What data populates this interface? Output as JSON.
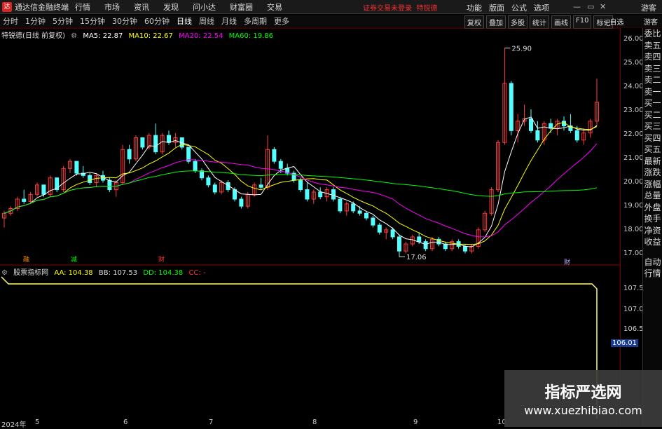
{
  "titlebar": {
    "app_title": "通达信金融终端",
    "menu": [
      "行情",
      "市场",
      "资讯",
      "发现",
      "问小达",
      "财富圈",
      "交易"
    ],
    "notice": "证券交易未登录",
    "notice2": "特锐德",
    "right_menu": [
      "功能",
      "版面",
      "公式",
      "选项"
    ],
    "guest": "游客"
  },
  "tabbar": {
    "tabs": [
      "分时",
      "1分钟",
      "5分钟",
      "15分钟",
      "30分钟",
      "60分钟",
      "日线",
      "周线",
      "月线",
      "多周期",
      "更多"
    ],
    "active": "日线",
    "tool_buttons": [
      "复权",
      "叠加",
      "多股",
      "统计",
      "画线",
      "F10",
      "标记"
    ],
    "auto_select": "+自选",
    "guest_btn": "游客"
  },
  "main_legend": {
    "name": "特锐德(日线 前复权)",
    "ma5": "MA5: 22.87",
    "ma10": "MA10: 22.67",
    "ma20": "MA20: 22.54",
    "ma60": "MA60: 19.86"
  },
  "sub_legend": {
    "name": "股票指标网",
    "aa": "AA: 104.38",
    "bb": "BB: 107.53",
    "dd": "DD: 104.38",
    "cc": "CC: -"
  },
  "price_axis": [
    "26.00",
    "25.00",
    "24.00",
    "23.00",
    "22.00",
    "21.00",
    "20.00",
    "19.00",
    "18.00",
    "17.00"
  ],
  "sub_axis": [
    "107.5",
    "107.0",
    "106.5",
    "106.01"
  ],
  "annotations": {
    "high": "25.90",
    "low": "17.06"
  },
  "markers": [
    "融",
    "减",
    "财",
    "财"
  ],
  "date_axis": [
    "2024年",
    "5",
    "6",
    "7",
    "8",
    "9",
    "10"
  ],
  "side_panel": [
    "委比",
    "卖五",
    "卖四",
    "卖三",
    "卖二",
    "卖一",
    "买一",
    "买二",
    "买三",
    "买四",
    "买五",
    "最新",
    "涨跌",
    "涨幅",
    "总量",
    "外盘",
    "换手",
    "净资",
    "收益",
    "自动",
    "行情"
  ],
  "watermark": {
    "line1": "指标严选网",
    "line2": "www.xuezhibiao.com"
  },
  "colors": {
    "up": "#ff3b3b",
    "down": "#54ffff",
    "ma5": "#ffffff",
    "ma10": "#ffff00",
    "ma20": "#ff00ff",
    "ma60": "#00ff00",
    "indicator": "#ffff66"
  },
  "chart_data": {
    "type": "candlestick",
    "title": "特锐德(日线 前复权)",
    "ylim": [
      16.8,
      26.3
    ],
    "candles": [
      [
        18.7,
        19.0,
        18.3,
        18.9
      ],
      [
        18.9,
        19.2,
        18.8,
        19.1
      ],
      [
        19.1,
        19.6,
        19.0,
        19.5
      ],
      [
        19.5,
        19.9,
        19.3,
        19.4
      ],
      [
        19.4,
        19.8,
        19.3,
        19.7
      ],
      [
        19.7,
        20.2,
        19.6,
        20.1
      ],
      [
        20.1,
        20.0,
        19.6,
        19.7
      ],
      [
        19.7,
        20.5,
        19.6,
        20.4
      ],
      [
        20.4,
        20.3,
        19.8,
        19.9
      ],
      [
        19.9,
        20.9,
        19.8,
        20.8
      ],
      [
        20.8,
        21.2,
        20.6,
        21.1
      ],
      [
        21.1,
        21.0,
        20.5,
        20.6
      ],
      [
        20.6,
        20.9,
        20.4,
        20.5
      ],
      [
        20.5,
        20.6,
        20.1,
        20.2
      ],
      [
        20.2,
        20.6,
        20.0,
        20.5
      ],
      [
        20.5,
        20.7,
        20.2,
        20.3
      ],
      [
        20.3,
        20.4,
        19.8,
        19.9
      ],
      [
        19.9,
        20.3,
        19.6,
        20.2
      ],
      [
        20.2,
        21.8,
        20.1,
        21.6
      ],
      [
        21.6,
        21.8,
        21.0,
        21.2
      ],
      [
        21.2,
        22.2,
        21.1,
        22.1
      ],
      [
        22.1,
        22.0,
        21.6,
        21.7
      ],
      [
        21.7,
        22.3,
        21.6,
        22.2
      ],
      [
        22.2,
        22.7,
        21.4,
        21.5
      ],
      [
        21.5,
        22.3,
        21.4,
        22.2
      ],
      [
        22.2,
        22.4,
        21.8,
        21.9
      ],
      [
        21.9,
        22.3,
        21.7,
        22.1
      ],
      [
        22.1,
        22.1,
        21.6,
        21.7
      ],
      [
        21.7,
        21.6,
        21.0,
        21.1
      ],
      [
        21.1,
        21.2,
        20.6,
        20.7
      ],
      [
        20.7,
        20.8,
        20.3,
        20.4
      ],
      [
        20.4,
        20.5,
        20.0,
        20.1
      ],
      [
        20.1,
        20.2,
        19.7,
        19.8
      ],
      [
        19.8,
        20.3,
        19.7,
        20.2
      ],
      [
        20.2,
        20.3,
        19.8,
        19.9
      ],
      [
        19.9,
        20.0,
        19.4,
        19.5
      ],
      [
        19.5,
        19.6,
        19.1,
        19.2
      ],
      [
        19.2,
        19.8,
        19.1,
        19.7
      ],
      [
        19.7,
        20.2,
        19.6,
        20.1
      ],
      [
        20.1,
        20.4,
        19.9,
        20.0
      ],
      [
        20.0,
        22.2,
        19.9,
        21.6
      ],
      [
        21.6,
        21.7,
        21.0,
        21.1
      ],
      [
        21.1,
        21.2,
        20.6,
        20.8
      ],
      [
        20.8,
        21.0,
        20.5,
        20.6
      ],
      [
        20.6,
        20.7,
        20.2,
        20.3
      ],
      [
        20.3,
        20.4,
        19.8,
        19.9
      ],
      [
        19.9,
        20.2,
        19.4,
        19.5
      ],
      [
        19.5,
        19.9,
        19.3,
        19.8
      ],
      [
        19.8,
        20.0,
        19.5,
        19.6
      ],
      [
        19.6,
        20.0,
        19.4,
        19.9
      ],
      [
        19.9,
        20.0,
        19.4,
        19.5
      ],
      [
        19.5,
        19.6,
        18.9,
        19.0
      ],
      [
        19.0,
        19.4,
        18.8,
        19.3
      ],
      [
        19.3,
        19.4,
        18.9,
        19.0
      ],
      [
        19.0,
        19.2,
        18.8,
        18.9
      ],
      [
        18.9,
        19.0,
        18.6,
        18.7
      ],
      [
        18.7,
        18.8,
        18.3,
        18.4
      ],
      [
        18.4,
        18.5,
        18.0,
        18.1
      ],
      [
        18.1,
        18.3,
        17.8,
        18.2
      ],
      [
        18.2,
        18.3,
        17.8,
        17.9
      ],
      [
        17.9,
        18.0,
        17.06,
        17.3
      ],
      [
        17.3,
        17.7,
        17.2,
        17.6
      ],
      [
        17.6,
        18.0,
        17.5,
        17.9
      ],
      [
        17.9,
        18.1,
        17.6,
        17.7
      ],
      [
        17.7,
        17.8,
        17.3,
        17.4
      ],
      [
        17.4,
        17.9,
        17.3,
        17.8
      ],
      [
        17.8,
        17.9,
        17.5,
        17.6
      ],
      [
        17.6,
        17.7,
        17.3,
        17.4
      ],
      [
        17.4,
        17.8,
        17.3,
        17.7
      ],
      [
        17.7,
        17.8,
        17.4,
        17.5
      ],
      [
        17.5,
        17.6,
        17.2,
        17.3
      ],
      [
        17.3,
        17.6,
        17.2,
        17.5
      ],
      [
        17.5,
        18.3,
        17.4,
        18.2
      ],
      [
        18.2,
        19.0,
        18.1,
        18.9
      ],
      [
        18.9,
        20.0,
        18.8,
        19.9
      ],
      [
        19.9,
        22.0,
        19.8,
        21.9
      ],
      [
        21.9,
        25.9,
        21.8,
        24.4
      ],
      [
        24.4,
        24.5,
        22.2,
        22.4
      ],
      [
        22.4,
        23.1,
        21.9,
        22.8
      ],
      [
        22.8,
        23.5,
        22.6,
        22.9
      ],
      [
        22.9,
        23.3,
        22.3,
        22.4
      ],
      [
        22.4,
        22.8,
        21.9,
        22.0
      ],
      [
        22.0,
        22.8,
        21.8,
        22.7
      ],
      [
        22.7,
        22.9,
        22.3,
        22.5
      ],
      [
        22.5,
        22.9,
        22.2,
        22.8
      ],
      [
        22.8,
        23.0,
        22.4,
        22.6
      ],
      [
        22.6,
        23.1,
        22.3,
        22.4
      ],
      [
        22.4,
        22.6,
        21.9,
        22.0
      ],
      [
        22.0,
        22.5,
        21.8,
        22.3
      ],
      [
        22.3,
        22.9,
        22.1,
        22.8
      ],
      [
        22.8,
        24.6,
        22.6,
        23.6
      ]
    ]
  }
}
